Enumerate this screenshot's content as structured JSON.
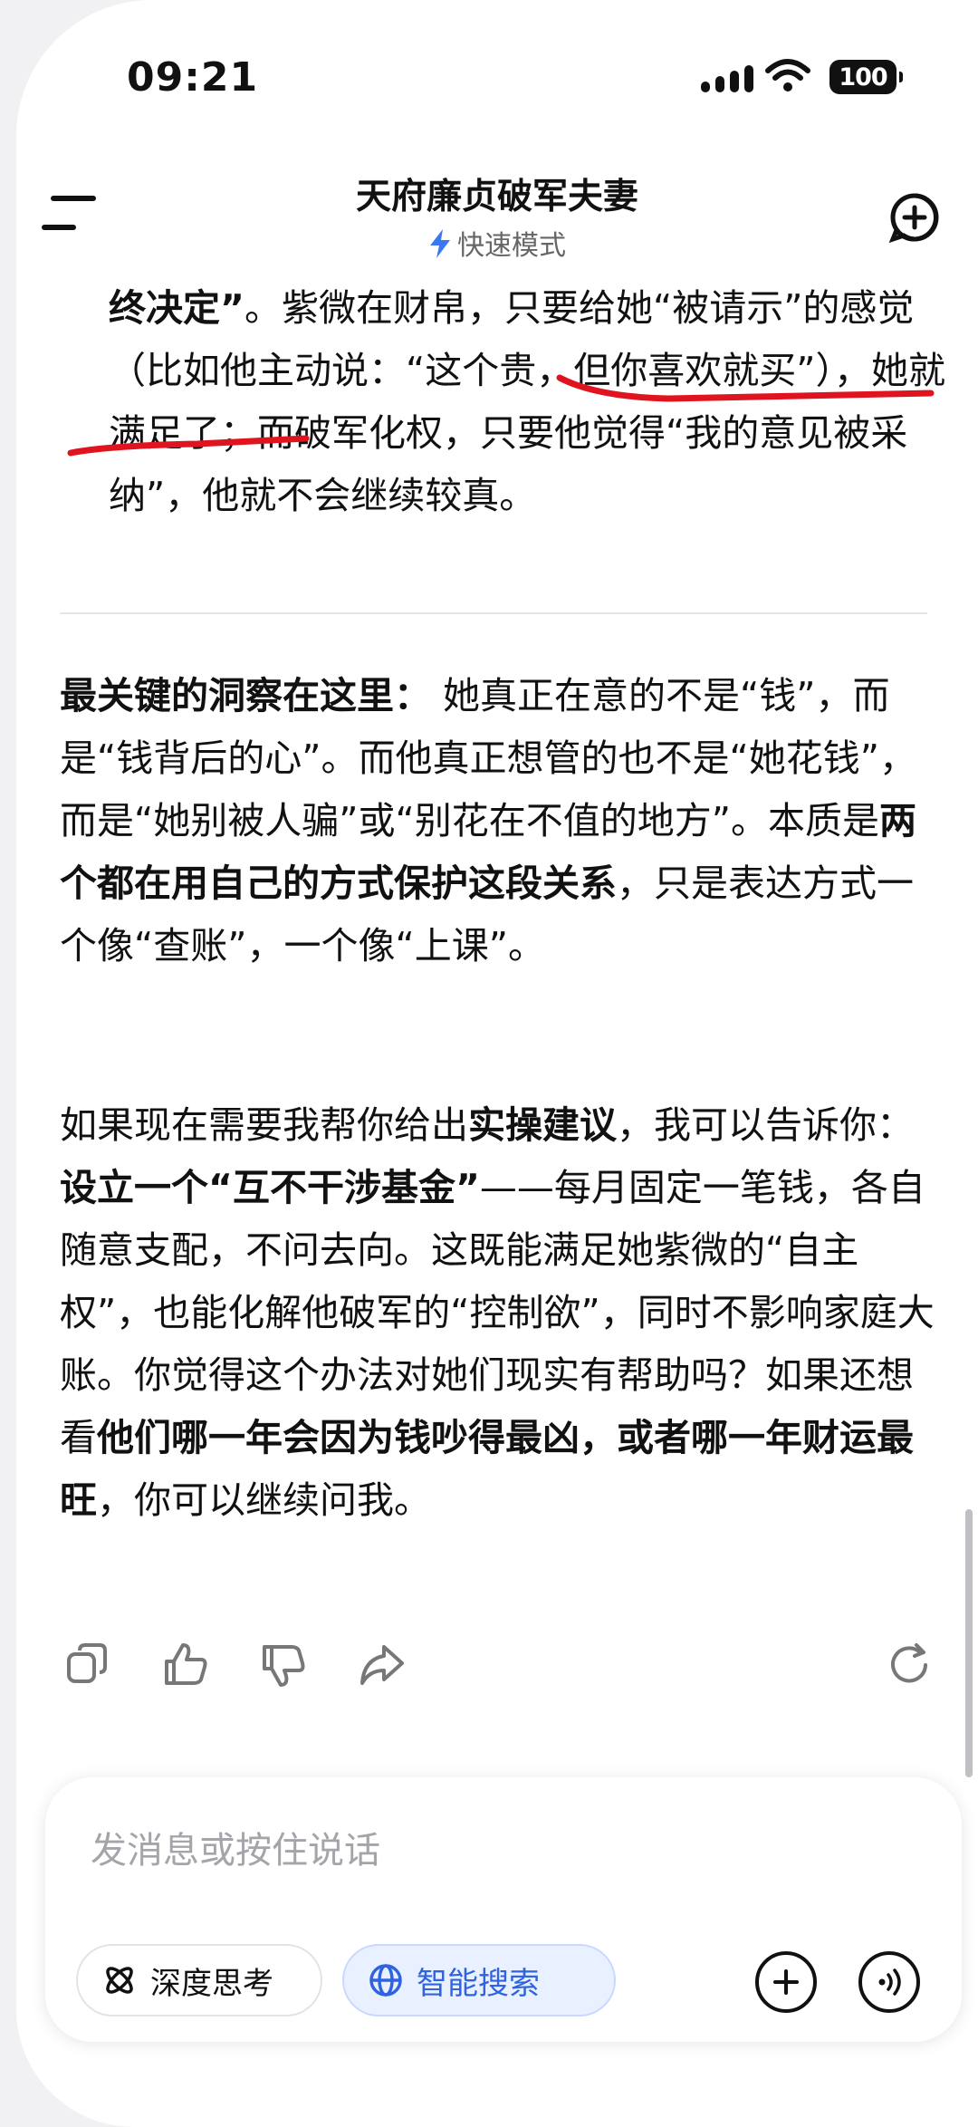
{
  "status": {
    "time": "09:21",
    "battery": "100"
  },
  "header": {
    "title": "天府廉贞破军夫妻",
    "mode": "快速模式"
  },
  "top_paragraph": {
    "s1_bold": "终决定”",
    "s1_rest": "。紫微在财帛，只要给她“被请示”的感觉（比如他主动说：“这个贵，但你喜欢就买”），她就满足了；而破军化权，只要他觉得“我的意见被采纳”，他就不会继续较真。"
  },
  "insight": {
    "lead_bold": "最关键的洞察在这里：",
    "t1": " 她真正在意的不是“钱”，而是“钱背后的心”。而他真正想管的也不是“她花钱”，而是“她别被人骗”或“别花在不值的地方”。本质是",
    "b1": "两个都在用自己的方式保护这段关系",
    "t2": "，只是表达方式一个像“查账”，一个像“上课”。"
  },
  "advice": {
    "t1": "如果现在需要我帮你给出",
    "b1": "实操建议",
    "t2": "，我可以告诉你：",
    "b2": "设立一个“互不干涉基金”",
    "t3": "——每月固定一笔钱，各自随意支配，不问去向。这既能满足她紫微的“自主权”，也能化解他破军的“控制欲”，同时不影响家庭大账。你觉得这个办法对她们现实有帮助吗？如果还想看",
    "b3": "他们哪一年会因为钱吵得最凶，或者哪一年财运最旺",
    "t4": "，你可以继续问我。"
  },
  "actions": [
    "copy-icon",
    "thumbs-up-icon",
    "thumbs-down-icon",
    "share-icon",
    "regenerate-icon"
  ],
  "input": {
    "placeholder": "发消息或按住说话",
    "deep_think_label": "深度思考",
    "smart_search_label": "智能搜索"
  },
  "colors": {
    "accent": "#2f63e0",
    "annotation": "#e0141e",
    "mode_icon": "#3a78f2"
  }
}
